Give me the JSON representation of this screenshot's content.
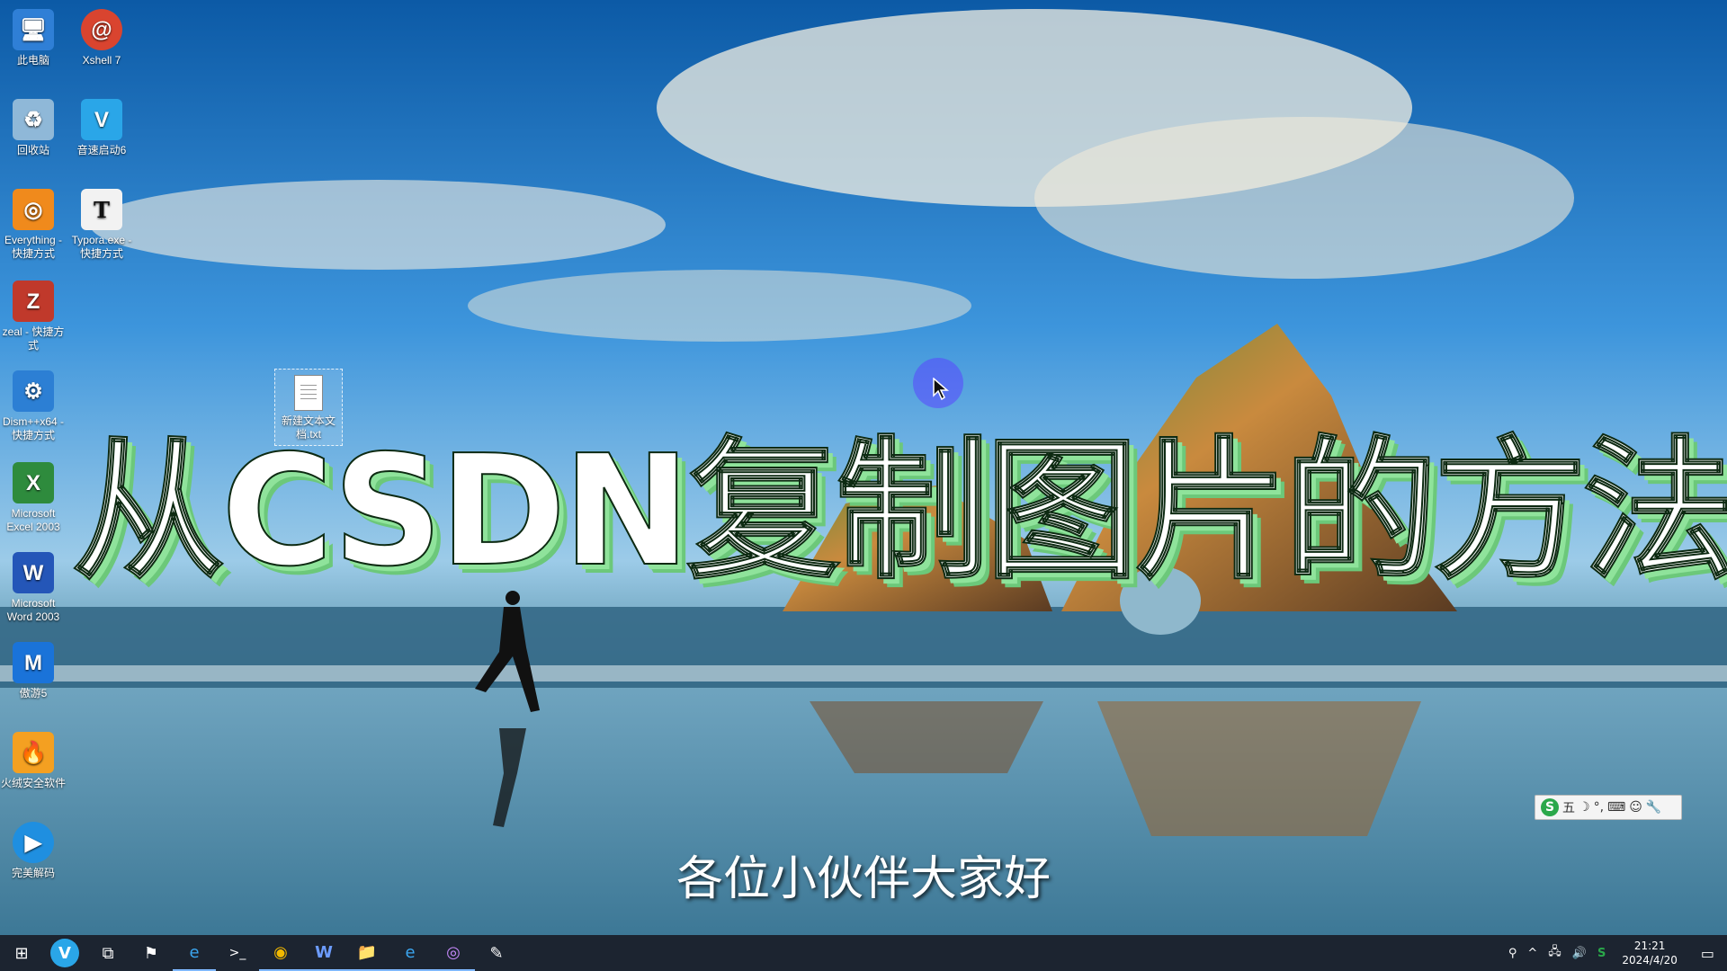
{
  "desktop": {
    "icons": [
      {
        "label": "此电脑",
        "glyph": "🖥",
        "color": "#2f7fd6"
      },
      {
        "label": "Xshell 7",
        "glyph": "@",
        "color": "#d9442f"
      },
      {
        "label": "回收站",
        "glyph": "♻",
        "color": "#8fb8d8"
      },
      {
        "label": "音速启动6",
        "glyph": "V",
        "color": "#2aa6e8"
      },
      {
        "label": "Everything - 快捷方式",
        "glyph": "◎",
        "color": "#f08a1c"
      },
      {
        "label": "Typora.exe - 快捷方式",
        "glyph": "T",
        "color": "#f2f2f2"
      },
      {
        "label": "zeal - 快捷方式",
        "glyph": "Z",
        "color": "#c0392b"
      },
      {
        "label": "Dism++x64 - 快捷方式",
        "glyph": "⚙",
        "color": "#2c7fd4"
      },
      {
        "label": "Microsoft Excel 2003",
        "glyph": "X",
        "color": "#2e8b3d"
      },
      {
        "label": "Microsoft Word 2003",
        "glyph": "W",
        "color": "#2456b8"
      },
      {
        "label": "傲游5",
        "glyph": "M",
        "color": "#1a73d9"
      },
      {
        "label": "火绒安全软件",
        "glyph": "🔥",
        "color": "#f4a021"
      },
      {
        "label": "完美解码",
        "glyph": "▶",
        "color": "#1f8fe0"
      }
    ],
    "selected_file": {
      "label": "新建文本文档.txt"
    }
  },
  "overlay": {
    "title": "从CSDN复制图片的方法",
    "subtitle": "各位小伙伴大家好"
  },
  "ime": {
    "logo": "S",
    "mode": "五",
    "items": [
      "☽",
      "°,",
      "⌨",
      "☺",
      "🔧"
    ]
  },
  "taskbar": {
    "apps": [
      {
        "name": "start",
        "glyph": "⊞"
      },
      {
        "name": "search",
        "glyph": "V"
      },
      {
        "name": "task-view",
        "glyph": "⧉"
      },
      {
        "name": "flag",
        "glyph": "⚑"
      },
      {
        "name": "edge",
        "glyph": "e"
      },
      {
        "name": "terminal",
        "glyph": ">_"
      },
      {
        "name": "chrome",
        "glyph": "◉"
      },
      {
        "name": "word",
        "glyph": "W"
      },
      {
        "name": "explorer",
        "glyph": "📁"
      },
      {
        "name": "edge-2",
        "glyph": "e"
      },
      {
        "name": "obs",
        "glyph": "◎"
      },
      {
        "name": "app",
        "glyph": "✎"
      }
    ],
    "tray": {
      "icons": [
        "⚲",
        "^",
        "🖧",
        "🔊",
        "S"
      ],
      "time": "21:21",
      "date": "2024/4/20"
    }
  }
}
